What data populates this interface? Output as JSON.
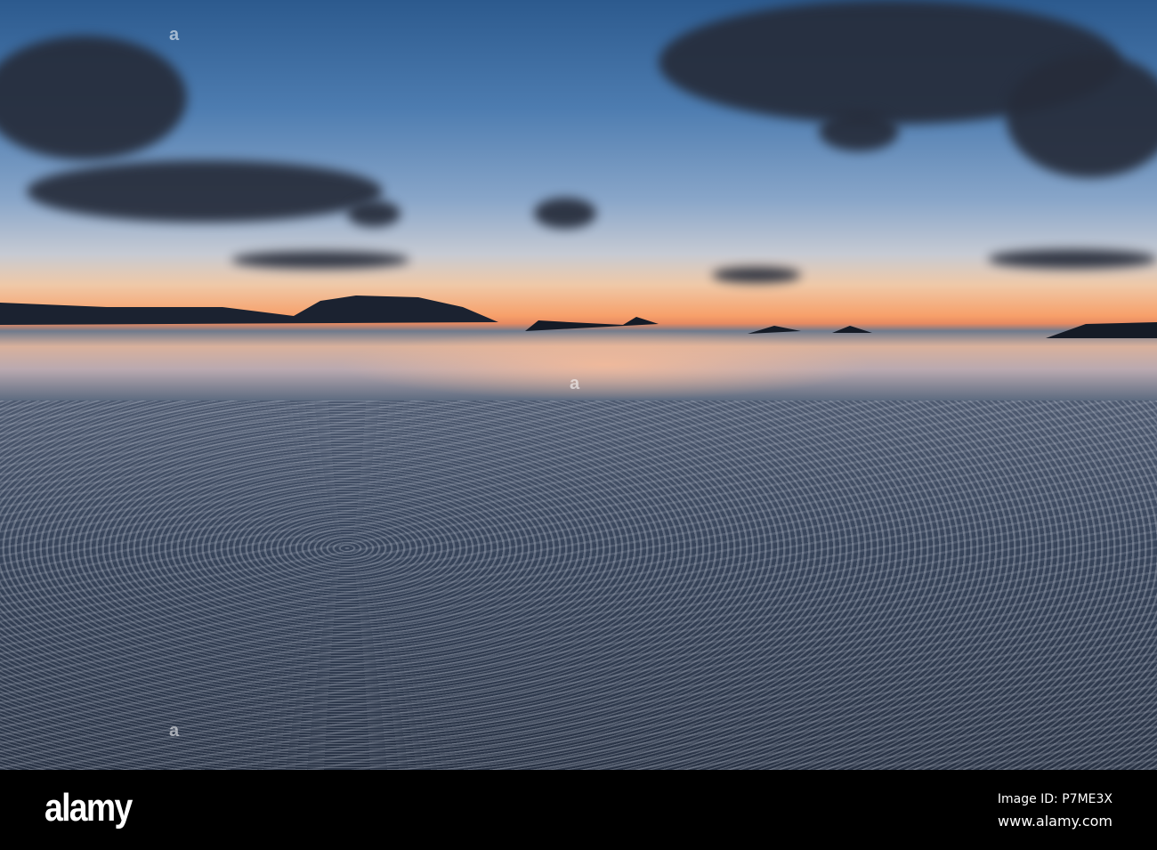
{
  "photo": {
    "subject": "sunset over rippled sand beach at low tide",
    "colors": {
      "sky_top": "#2c5a8e",
      "horizon": "#f7a06a",
      "sand": "#37445a"
    }
  },
  "watermark": {
    "logo": "alamy",
    "image_id": "Image ID: P7ME3X",
    "site": "www.alamy.com"
  }
}
